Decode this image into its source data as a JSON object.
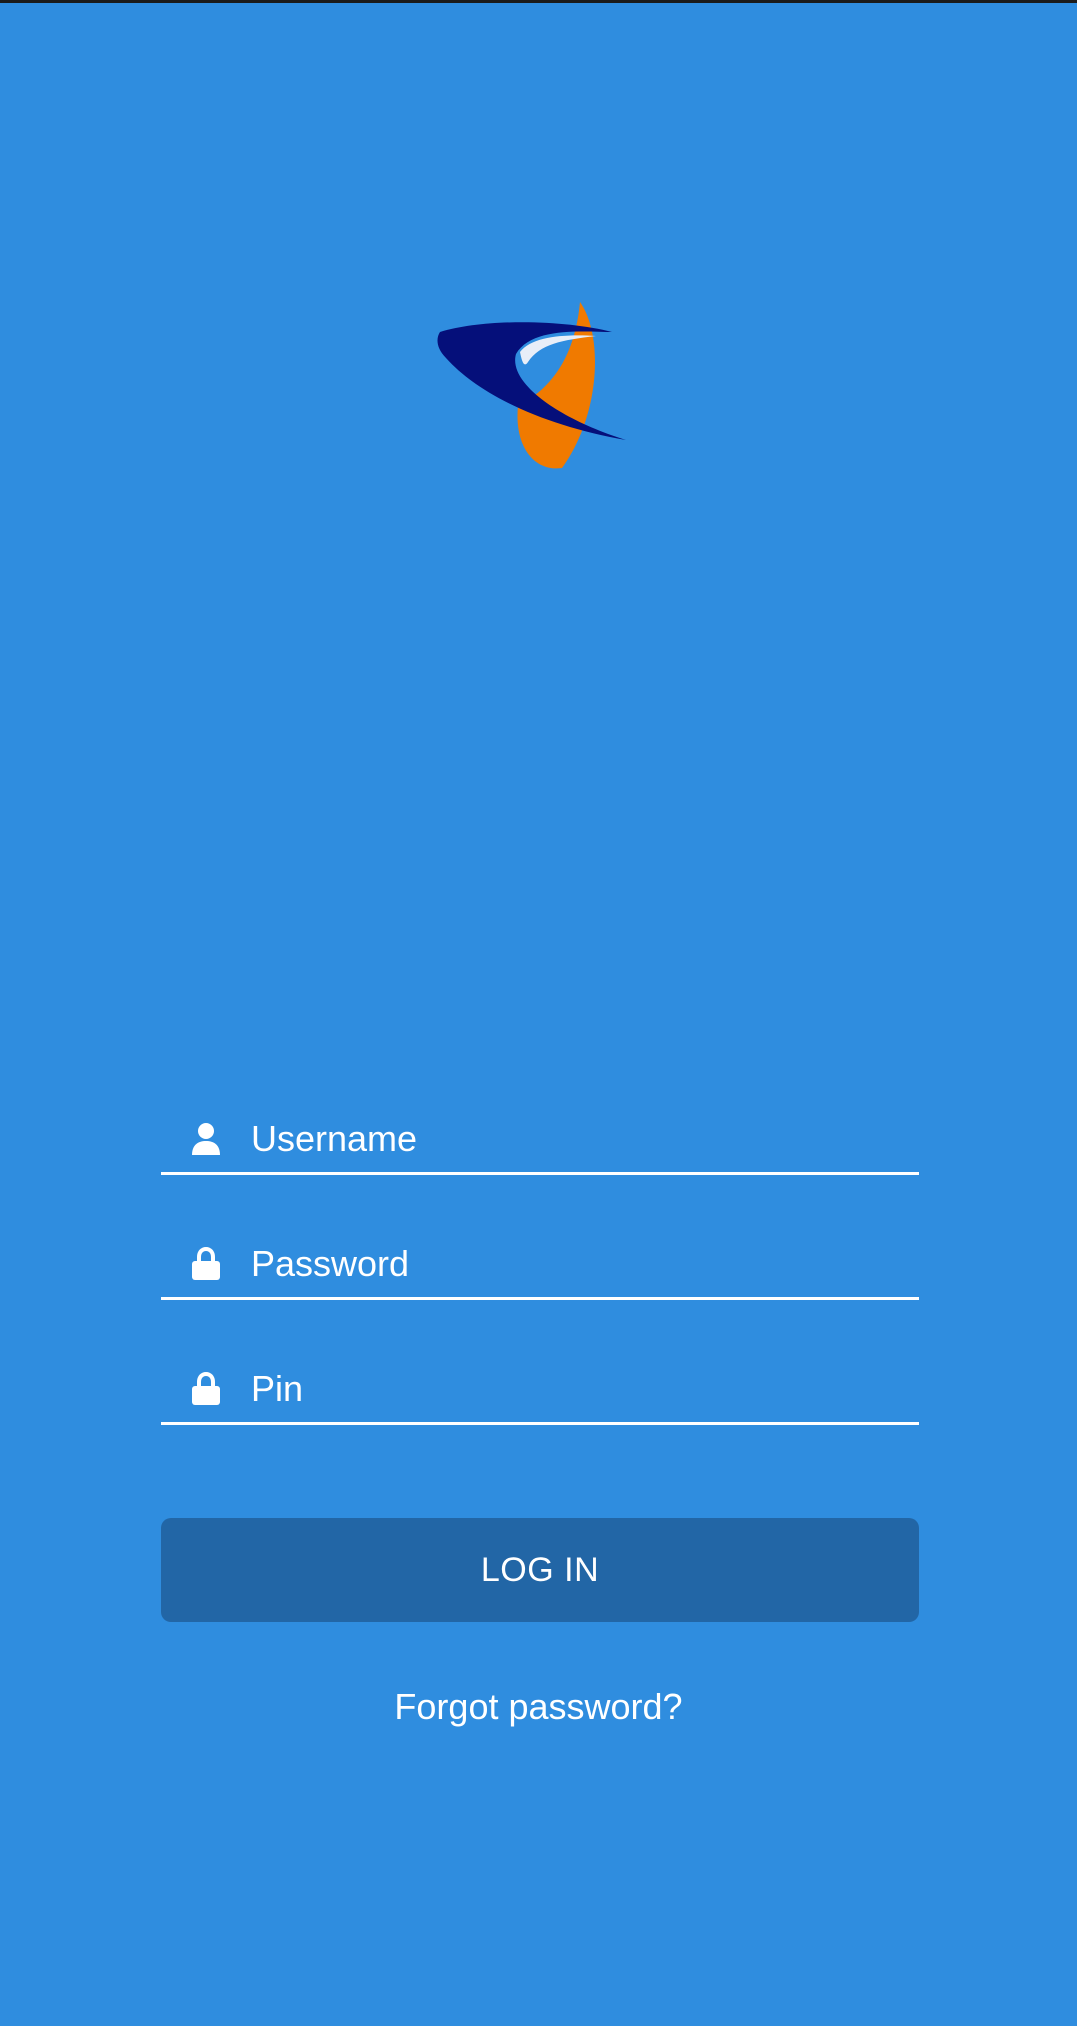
{
  "colors": {
    "background": "#2f8ddf",
    "button_background": "#2266a6",
    "text": "#ffffff",
    "logo_navy": "#050f7a",
    "logo_orange": "#f07a00"
  },
  "logo": {
    "icon": "brand-logo"
  },
  "form": {
    "username": {
      "placeholder": "Username",
      "value": "",
      "icon": "user-icon"
    },
    "password": {
      "placeholder": "Password",
      "value": "",
      "icon": "lock-icon"
    },
    "pin": {
      "placeholder": "Pin",
      "value": "",
      "icon": "lock-icon"
    },
    "login_label": "LOG IN",
    "forgot_label": "Forgot password?"
  }
}
